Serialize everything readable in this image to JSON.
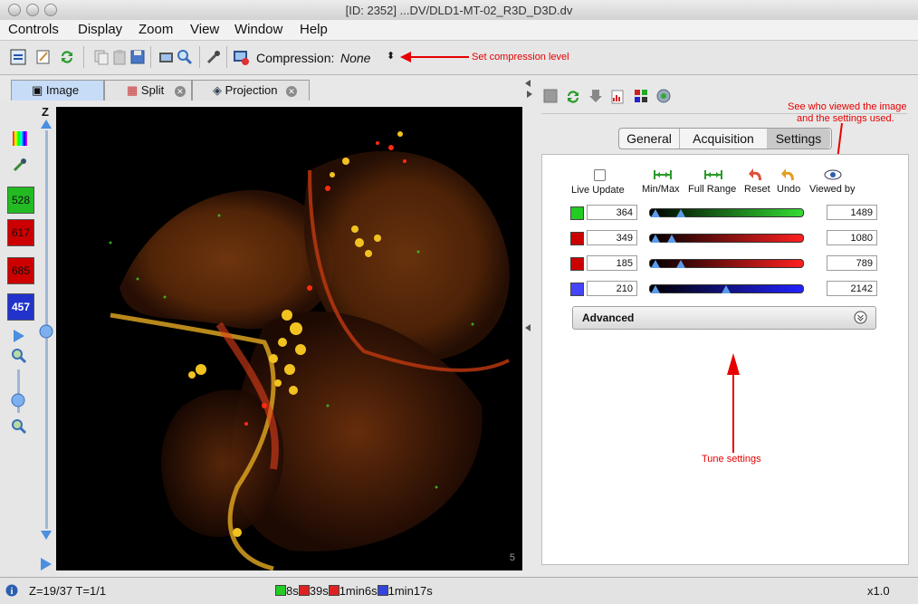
{
  "window": {
    "title": "[ID: 2352] ...DV/DLD1-MT-02_R3D_D3D.dv"
  },
  "menu": [
    "Controls",
    "Display",
    "Zoom",
    "View",
    "Window",
    "Help"
  ],
  "toolbar": {
    "compression_label": "Compression:",
    "compression_value": "None",
    "annotation": "Set compression level"
  },
  "view_tabs": [
    "Image",
    "Split",
    "Projection"
  ],
  "left_tools": {
    "z_label": "Z",
    "channels": [
      {
        "label": "528",
        "color": "#22bb22"
      },
      {
        "label": "617",
        "color": "#cc0000"
      },
      {
        "label": "685",
        "color": "#cc0000"
      },
      {
        "label": "457",
        "color": "#2233cc"
      }
    ]
  },
  "image": {
    "scale_mark": "5"
  },
  "right_panel": {
    "tabs": [
      "General",
      "Acquisition",
      "Settings"
    ],
    "annotation_viewed": [
      "See who viewed the image",
      "and the settings used."
    ],
    "annotation_tune": "Tune settings",
    "actions": [
      {
        "label": "Live Update",
        "icon": "checkbox-icon"
      },
      {
        "label": "Min/Max",
        "icon": "min-max-icon"
      },
      {
        "label": "Full Range",
        "icon": "full-range-icon"
      },
      {
        "label": "Reset",
        "icon": "reset-arrow-icon"
      },
      {
        "label": "Undo",
        "icon": "undo-arrow-icon"
      },
      {
        "label": "Viewed by",
        "icon": "eye-icon"
      }
    ],
    "channels": [
      {
        "min": "364",
        "max": "1489",
        "color": "#22cc22",
        "gradient": [
          "#000000",
          "#33dd33"
        ],
        "min_fraction": 0.04,
        "max_fraction": 0.21
      },
      {
        "min": "349",
        "max": "1080",
        "color": "#cc0000",
        "gradient": [
          "#000000",
          "#ff2020"
        ],
        "min_fraction": 0.04,
        "max_fraction": 0.15
      },
      {
        "min": "185",
        "max": "789",
        "color": "#cc0000",
        "gradient": [
          "#000000",
          "#ff2020"
        ],
        "min_fraction": 0.04,
        "max_fraction": 0.21
      },
      {
        "min": "210",
        "max": "2142",
        "color": "#4444ff",
        "gradient": [
          "#000000",
          "#2222ff"
        ],
        "min_fraction": 0.04,
        "max_fraction": 0.5
      }
    ],
    "advanced_label": "Advanced"
  },
  "status": {
    "position": "Z=19/37 T=1/1",
    "timings": [
      {
        "label": "8s",
        "color": "#22cc22"
      },
      {
        "label": "39s",
        "color": "#dd2222"
      },
      {
        "label": "1min6s",
        "color": "#dd2222"
      },
      {
        "label": "1min17s",
        "color": "#3344dd"
      }
    ],
    "zoom": "x1.0"
  }
}
